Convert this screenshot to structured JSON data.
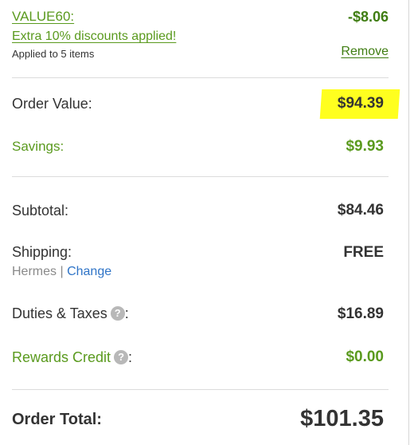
{
  "coupon": {
    "code": "VALUE60:",
    "message": "Extra 10% discounts applied!",
    "applied_to": "Applied to 5 items",
    "discount": "-$8.06",
    "remove_label": "Remove"
  },
  "order_value": {
    "label": "Order Value:",
    "value": "$94.39"
  },
  "savings": {
    "label": "Savings:",
    "value": "$9.93"
  },
  "subtotal": {
    "label": "Subtotal:",
    "value": "$84.46"
  },
  "shipping": {
    "label": "Shipping:",
    "value": "FREE",
    "carrier": "Hermes",
    "separator": "|",
    "change_label": "Change"
  },
  "duties": {
    "label": "Duties & Taxes",
    "help_icon": "?",
    "colon": ":",
    "value": "$16.89"
  },
  "rewards": {
    "label": "Rewards Credit",
    "help_icon": "?",
    "colon": ":",
    "value": "$0.00"
  },
  "total": {
    "label": "Order Total:",
    "value": "$101.35"
  },
  "colors": {
    "green": "#5a9a1e",
    "link_blue": "#2f74c7",
    "highlight": "#ffff1f",
    "text": "#333333"
  }
}
